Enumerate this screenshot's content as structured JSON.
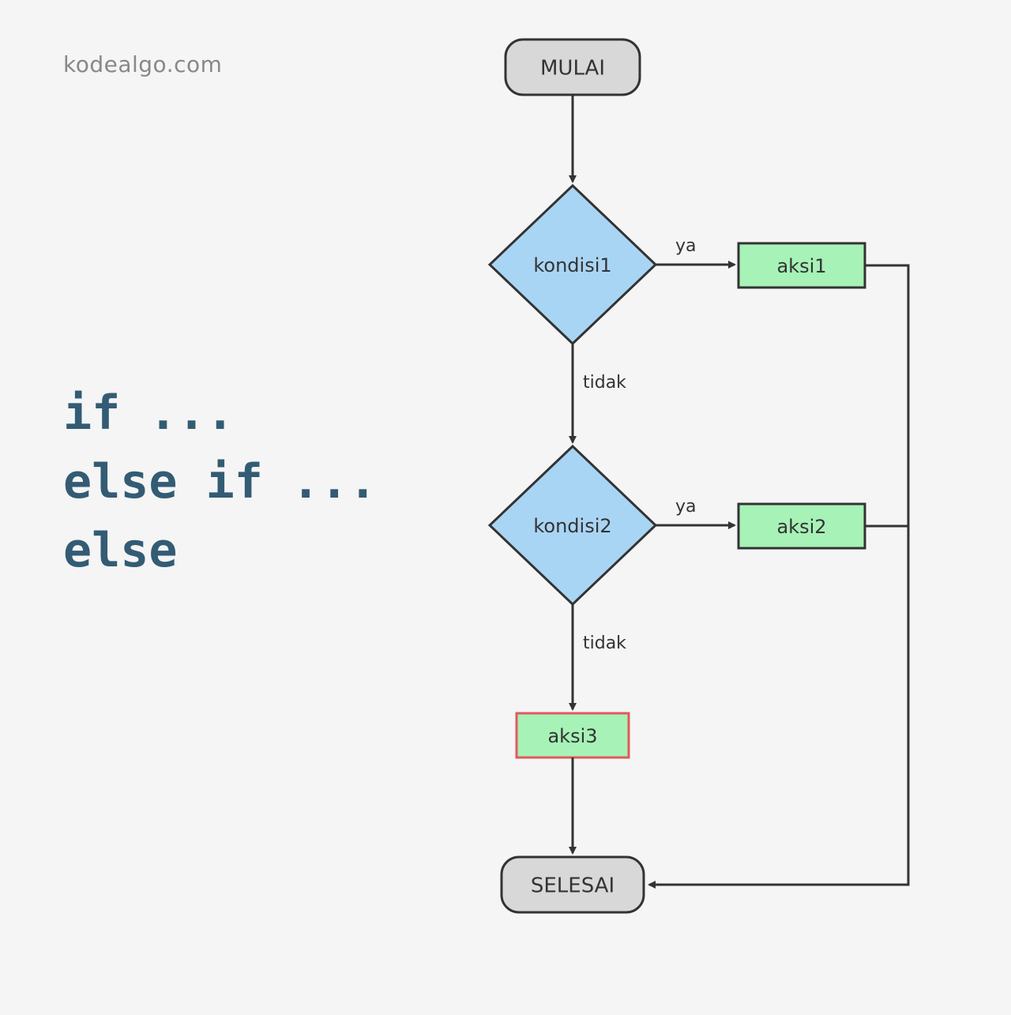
{
  "watermark": "kodealgo.com",
  "code_lines": {
    "line1": "if ...",
    "line2": "else if ...",
    "line3": "else"
  },
  "nodes": {
    "start": "MULAI",
    "cond1": "kondisi1",
    "cond2": "kondisi2",
    "act1": "aksi1",
    "act2": "aksi2",
    "act3": "aksi3",
    "end": "SELESAI"
  },
  "labels": {
    "yes": "ya",
    "no": "tidak"
  },
  "colors": {
    "terminal_fill": "#d8d8d8",
    "decision_fill": "#a9d5f5",
    "process_fill": "#a6f2b7",
    "stroke_dark": "#333333",
    "stroke_red": "#e05a5a"
  }
}
